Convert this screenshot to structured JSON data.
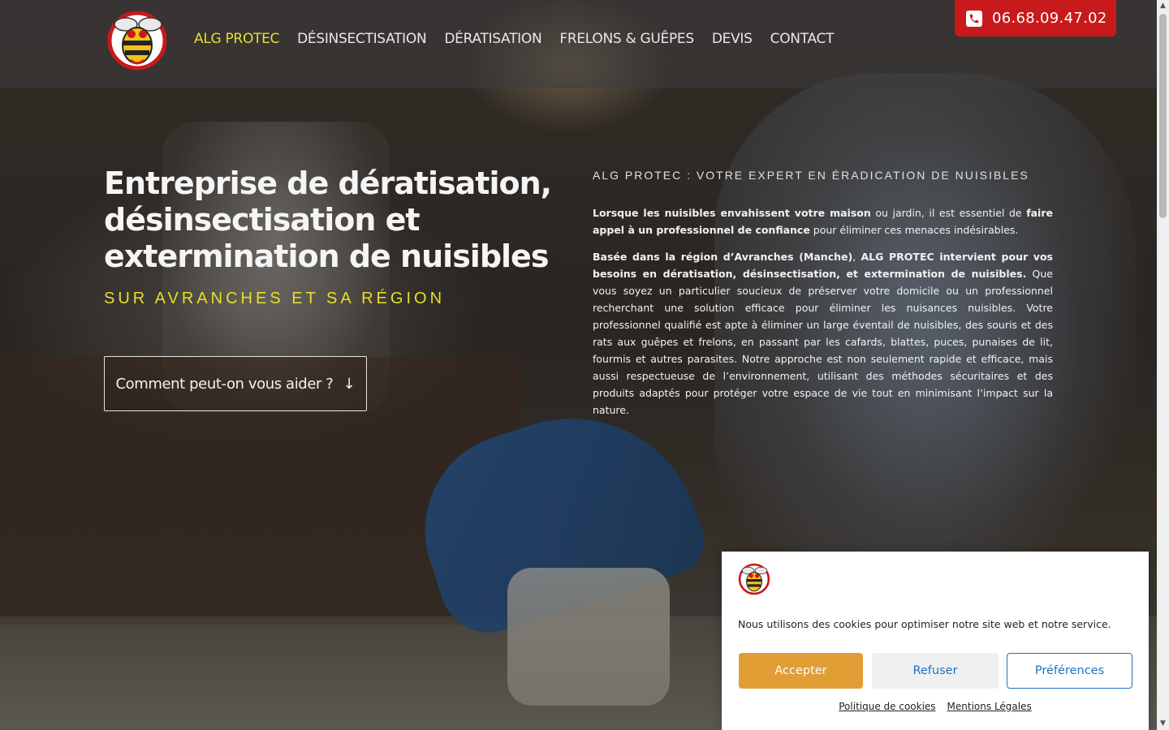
{
  "header": {
    "nav": [
      "ALG PROTEC",
      "DÉSINSECTISATION",
      "DÉRATISATION",
      "FRELONS & GUÊPES",
      "DEVIS",
      "CONTACT"
    ],
    "phone": "06.68.09.47.02",
    "colors": {
      "accent": "#e8df2a",
      "phone_bg": "#c8191c"
    }
  },
  "hero": {
    "title": "Entreprise de dératisation, désinsectisation et extermination de nuisibles",
    "subtitle": "SUR AVRANCHES ET SA RÉGION",
    "cta": "Comment peut-on vous aider ?",
    "cta_icon": "arrow-down-icon",
    "kicker": "ALG PROTEC : VOTRE EXPERT EN ÉRADICATION DE NUISIBLES",
    "p1": {
      "b1": "Lorsque les nuisibles envahissent votre maison",
      "t1": " ou jardin, il est essentiel de ",
      "b2": "faire appel à un professionnel de confiance",
      "t2": " pour éliminer ces menaces indésirables."
    },
    "p2": {
      "b1": "Basée dans la région d’Avranches (Manche)",
      "t1": ", ",
      "b2": "ALG PROTEC intervient pour vos besoins en dératisation, désinsectisation, et extermination de nuisibles.",
      "t2": " Que vous soyez un particulier soucieux de préserver votre domicile ou un professionnel recherchant une solution efficace pour éliminer les nuisances nuisibles. Votre professionnel qualifié est apte à éliminer un large éventail de nuisibles, des souris et des rats aux guêpes et frelons, en passant par les cafards, blattes, puces, punaises de lit, fourmis et autres parasites. Notre approche est non seulement rapide et efficace, mais aussi respectueuse de l’environnement, utilisant des méthodes sécuritaires et des produits adaptés pour protéger votre espace de vie tout en minimisant l’impact sur la nature."
    }
  },
  "cookie": {
    "message": "Nous utilisons des cookies pour optimiser notre site web et notre service.",
    "accept": "Accepter",
    "refuse": "Refuser",
    "preferences": "Préférences",
    "link_policy": "Politique de cookies",
    "link_legal": "Mentions Légales",
    "colors": {
      "accept_bg": "#e09e35",
      "link": "#1e73be"
    }
  },
  "scrollbar": {
    "up_icon": "scroll-up-arrow-icon",
    "down_icon": "scroll-down-arrow-icon"
  }
}
